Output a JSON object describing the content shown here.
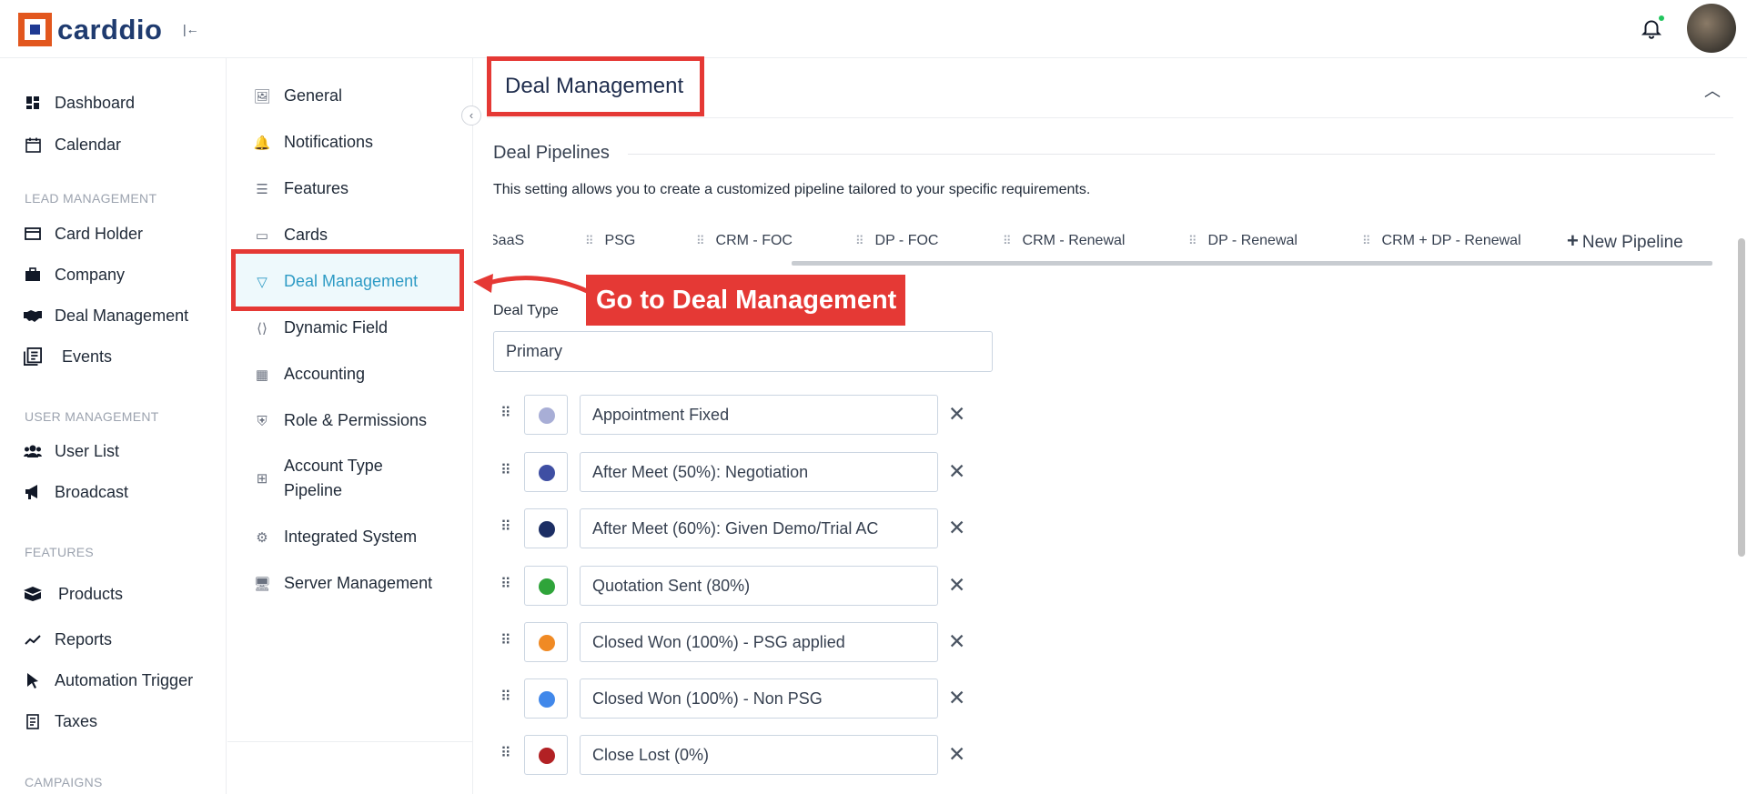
{
  "app": {
    "logo_text": "carddio",
    "collapse_icon": "|←"
  },
  "sidebar": {
    "top_items": [
      {
        "label": "Dashboard",
        "icon": "dashboard-icon"
      },
      {
        "label": "Calendar",
        "icon": "calendar-icon"
      }
    ],
    "sections": [
      {
        "title": "LEAD MANAGEMENT",
        "items": [
          {
            "label": "Card Holder",
            "icon": "card-icon"
          },
          {
            "label": "Company",
            "icon": "briefcase-icon"
          },
          {
            "label": "Deal Management",
            "icon": "handshake-icon"
          },
          {
            "label": "Events",
            "icon": "events-icon"
          }
        ]
      },
      {
        "title": "USER MANAGEMENT",
        "items": [
          {
            "label": "User List",
            "icon": "users-icon"
          },
          {
            "label": "Broadcast",
            "icon": "megaphone-icon"
          }
        ]
      },
      {
        "title": "FEATURES",
        "items": [
          {
            "label": "Products",
            "icon": "box-icon"
          },
          {
            "label": "Reports",
            "icon": "trend-icon"
          },
          {
            "label": "Automation Trigger",
            "icon": "cursor-icon"
          },
          {
            "label": "Taxes",
            "icon": "receipt-icon"
          }
        ]
      },
      {
        "title": "CAMPAIGNS",
        "items": []
      }
    ]
  },
  "settings_menu": {
    "items": [
      {
        "label": "General",
        "icon": "general-icon"
      },
      {
        "label": "Notifications",
        "icon": "bell-outline-icon"
      },
      {
        "label": "Features",
        "icon": "layers-icon"
      },
      {
        "label": "Cards",
        "icon": "id-card-icon"
      },
      {
        "label": "Deal Management",
        "icon": "funnel-icon",
        "active": true
      },
      {
        "label": "Dynamic Field",
        "icon": "code-icon"
      },
      {
        "label": "Accounting",
        "icon": "calculator-icon"
      },
      {
        "label": "Role & Permissions",
        "icon": "shield-key-icon"
      },
      {
        "label": "Account Type Pipeline",
        "icon": "grid-icon"
      },
      {
        "label": "Integrated System",
        "icon": "plug-icon"
      },
      {
        "label": "Server Management",
        "icon": "server-icon"
      }
    ]
  },
  "panel": {
    "title": "Deal Management",
    "section_title": "Deal Pipelines",
    "section_desc": "This setting allows you to create a customized pipeline tailored to your specific requirements.",
    "tabs": [
      "SaaS",
      "PSG",
      "CRM - FOC",
      "DP - FOC",
      "CRM - Renewal",
      "DP - Renewal",
      "CRM + DP - Renewal"
    ],
    "new_pipeline_label": "New Pipeline",
    "deal_type_label": "Deal Type",
    "deal_type_value": "Primary",
    "stages": [
      {
        "label": "Appointment Fixed",
        "color": "#a8aed6"
      },
      {
        "label": "After Meet (50%): Negotiation",
        "color": "#3f4fa3"
      },
      {
        "label": "After Meet (60%): Given Demo/Trial AC",
        "color": "#1c2e64"
      },
      {
        "label": "Quotation Sent (80%)",
        "color": "#2fa43a"
      },
      {
        "label": "Closed Won (100%) - PSG applied",
        "color": "#f08a24"
      },
      {
        "label": "Closed Won (100%) - Non PSG",
        "color": "#4188ea"
      },
      {
        "label": "Close Lost (0%)",
        "color": "#b22124"
      }
    ]
  },
  "annotation": {
    "callout_text": "Go to Deal Management",
    "highlight_color": "#e53935"
  }
}
